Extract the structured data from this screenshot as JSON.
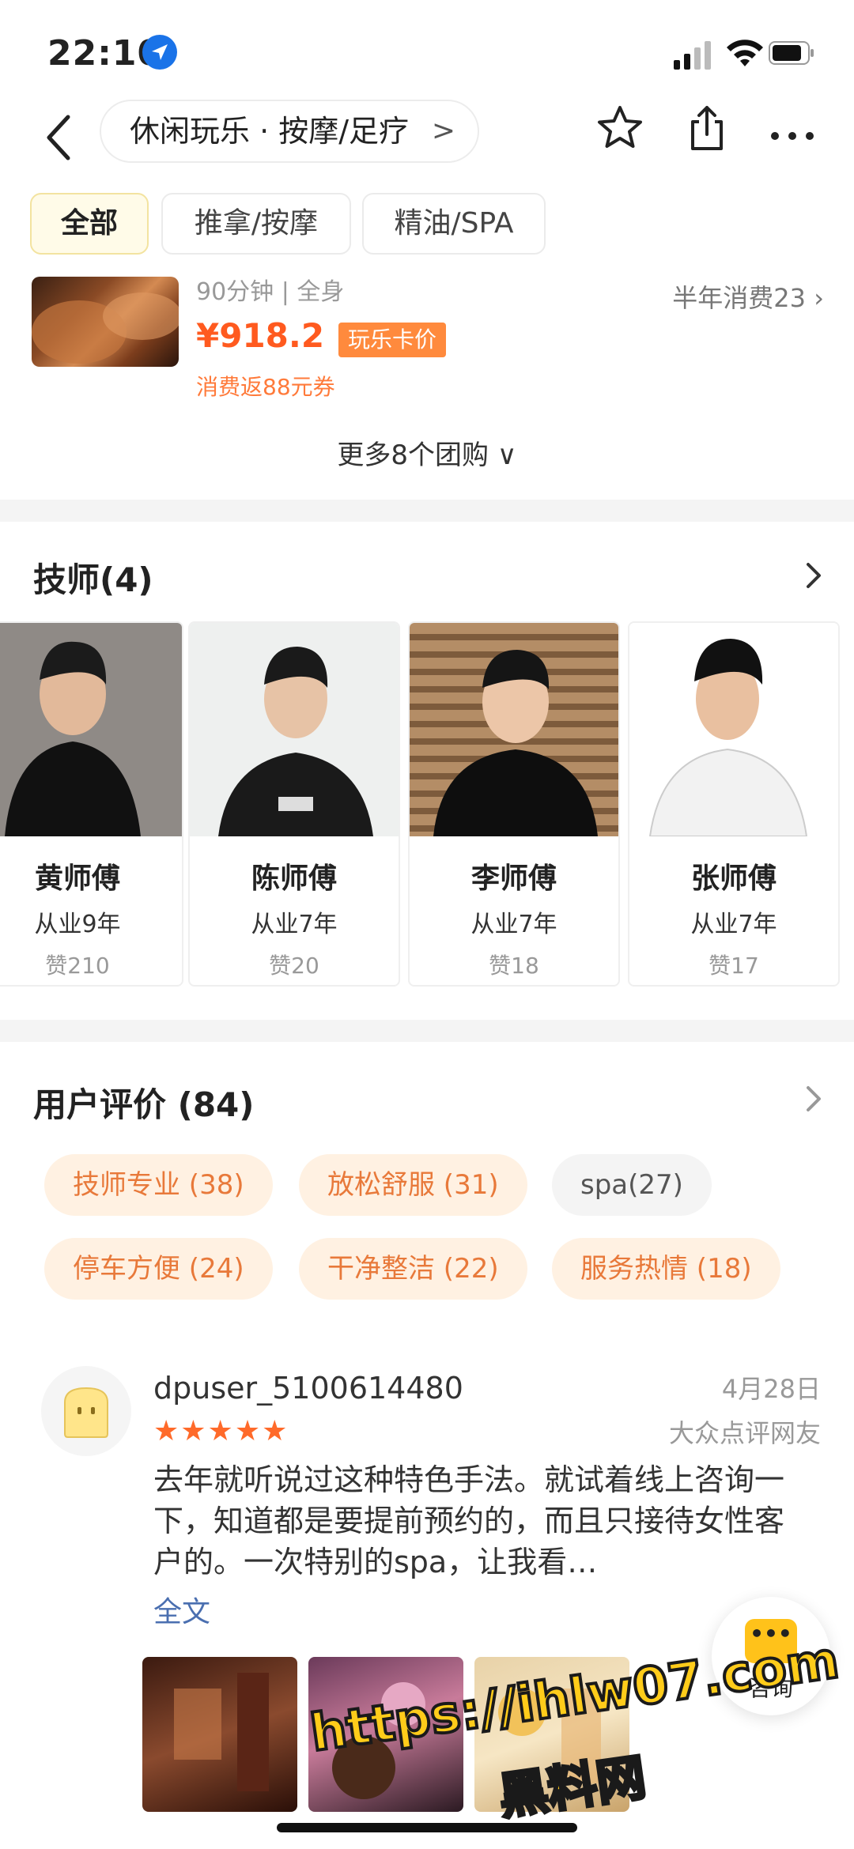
{
  "status_bar": {
    "time": "22:10"
  },
  "nav": {
    "breadcrumb": "休闲玩乐 · 按摩/足疗",
    "breadcrumb_chevron": ">"
  },
  "tabs": [
    {
      "label": "全部",
      "active": true
    },
    {
      "label": "推拿/按摩",
      "active": false
    },
    {
      "label": "精油/SPA",
      "active": false
    }
  ],
  "deal": {
    "subtitle": "90分钟 | 全身",
    "stats": "半年消费23",
    "price": "¥918.2",
    "price_badge": "玩乐卡价",
    "rebate": "消费返88元券",
    "more": "更多8个团购"
  },
  "technicians": {
    "title": "技师(4)",
    "items": [
      {
        "name": "黄师傅",
        "years": "从业9年",
        "likes": "赞210"
      },
      {
        "name": "陈师傅",
        "years": "从业7年",
        "likes": "赞20"
      },
      {
        "name": "李师傅",
        "years": "从业7年",
        "likes": "赞18"
      },
      {
        "name": "张师傅",
        "years": "从业7年",
        "likes": "赞17"
      }
    ]
  },
  "reviews": {
    "title": "用户评价 (84)",
    "tags": [
      "技师专业 (38)",
      "放松舒服 (31)",
      "spa(27)",
      "停车方便 (24)",
      "干净整洁 (22)",
      "服务热情 (18)"
    ],
    "first": {
      "user": "dpuser_5100614480",
      "stars": "★★★★★",
      "date": "4月28日",
      "source": "大众点评网友",
      "body": "去年就听说过这种特色手法。就试着线上咨询一下，知道都是要提前预约的，而且只接待女性客户的。一次特别的spa，让我看…",
      "full_text": "全文"
    }
  },
  "chat": {
    "label": "咨询",
    "dots": "•••"
  },
  "watermark": {
    "line1": "https://ihlw07.com",
    "line2": "黑料网"
  },
  "colors": {
    "accent_orange": "#ff5a1f",
    "chip_bg": "#fff1e2",
    "star": "#ff6a2a",
    "link": "#4a6fb0"
  }
}
